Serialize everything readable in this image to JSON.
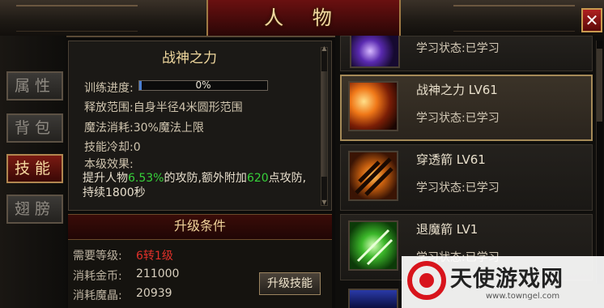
{
  "window": {
    "title": "人 物",
    "close_label": "✕"
  },
  "tabs": [
    {
      "label": "属性",
      "active": false
    },
    {
      "label": "背包",
      "active": false
    },
    {
      "label": "技能",
      "active": true
    },
    {
      "label": "翅膀",
      "active": false
    }
  ],
  "detail": {
    "skill_name": "战神之力",
    "progress_label": "训练进度:",
    "progress_text": "0%",
    "progress_fraction": 0.0,
    "range_label": "释放范围:",
    "range_value": "自身半径4米圆形范围",
    "cost_label": "魔法消耗:",
    "cost_value": "30%魔法上限",
    "cooldown_label": "技能冷却:",
    "cooldown_value": "0",
    "effect_label": "本级效果:",
    "effect_pre": "提升人物",
    "effect_pct": "6.53%",
    "effect_mid": "的攻防,额外附加",
    "effect_num": "620",
    "effect_post": "点攻防,持续1800秒"
  },
  "upgrade": {
    "title": "升级条件",
    "level_label": "需要等级:",
    "level_value": "6转1级",
    "gold_label": "消耗金币:",
    "gold_value": "211000",
    "crystal_label": "消耗魔晶:",
    "crystal_value": "20939",
    "button_label": "升级技能"
  },
  "skills": [
    {
      "name": "",
      "status": "学习状态:已学习",
      "selected": false
    },
    {
      "name": "战神之力 LV61",
      "status": "学习状态:已学习",
      "selected": true
    },
    {
      "name": "穿透箭 LV61",
      "status": "学习状态:已学习",
      "selected": false
    },
    {
      "name": "退魔箭 LV1",
      "status": "学习状态:已学习",
      "selected": false
    }
  ],
  "colors": {
    "accent": "#a58a58",
    "highlight_green": "#36d13a",
    "warning_red": "#e0302a",
    "title_gold": "#f2d9a0"
  },
  "watermark": {
    "text": "天使游戏网",
    "url": "www.towngel.com"
  }
}
